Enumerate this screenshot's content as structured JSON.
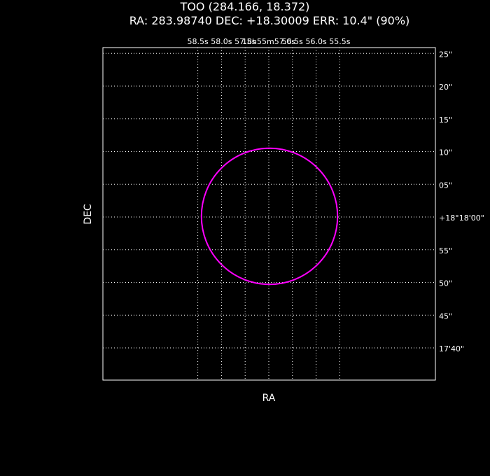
{
  "title": "TOO (284.166, 18.372)",
  "subtitle": "RA: 283.98740   DEC: +18.30009   ERR: 10.4\" (90%)",
  "chart_data": {
    "type": "scatter",
    "xlabel": "RA",
    "ylabel": "DEC",
    "grid": true,
    "x_ticks": [
      "58.5s",
      "58.0s",
      "57.5s",
      "18h55m57.0s",
      "56.5s",
      "56.0s",
      "55.5s"
    ],
    "y_ticks": [
      "25\"",
      "20\"",
      "15\"",
      "10\"",
      "05\"",
      "+18°18'00\"",
      "55\"",
      "50\"",
      "45\"",
      "17'40\""
    ],
    "center": {
      "ra_deg": 283.9874,
      "dec_deg": 18.30009
    },
    "error_radius_arcsec": 10.4,
    "confidence": "90%",
    "circle_color": "#ff00ff"
  }
}
